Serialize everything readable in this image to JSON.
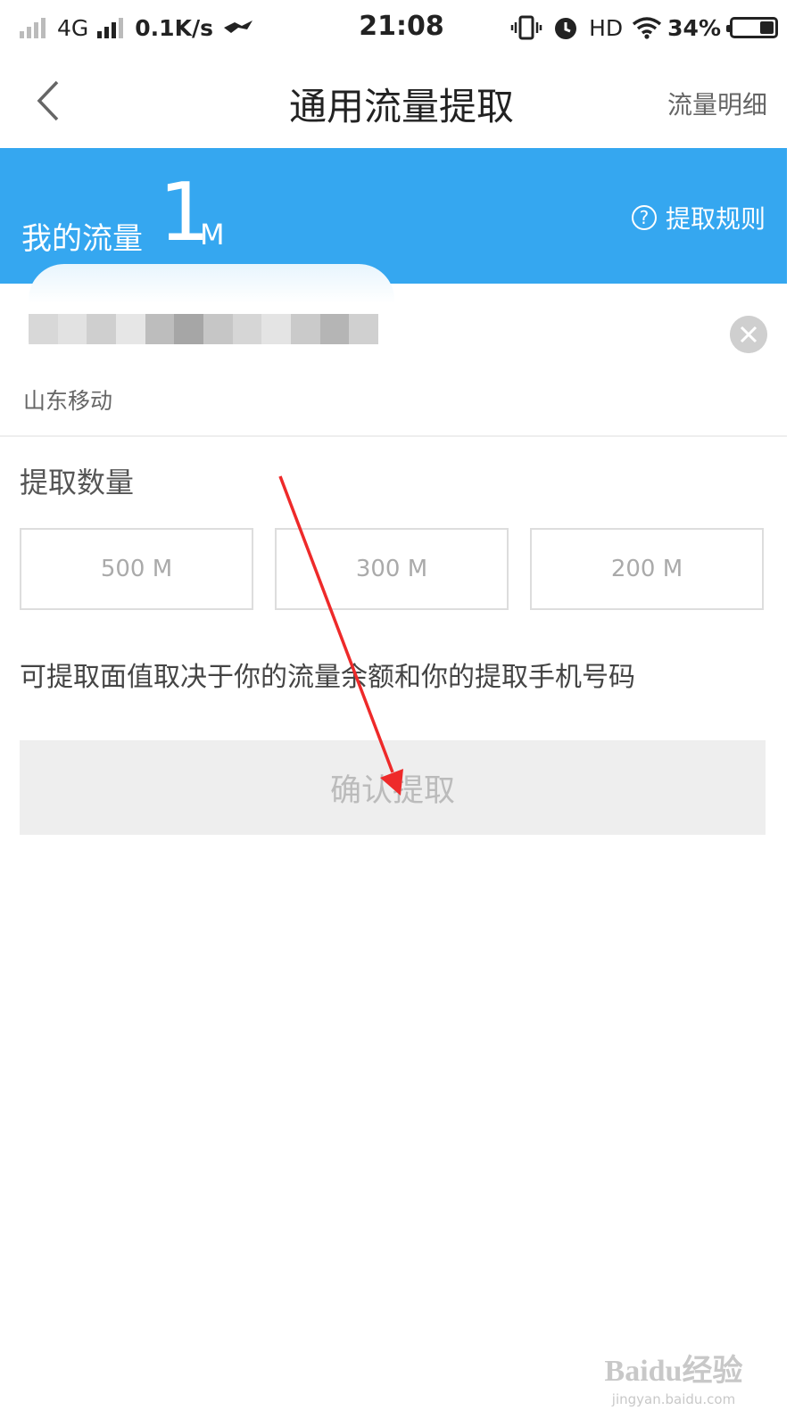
{
  "status_bar": {
    "network": "4G",
    "speed": "0.1K/s",
    "time": "21:08",
    "hd": "HD",
    "battery": "34%",
    "icons": [
      "signal-icon",
      "signal-icon",
      "hotspot-icon",
      "vibrate-icon",
      "alarm-icon",
      "wifi-icon",
      "battery-icon"
    ]
  },
  "nav": {
    "title": "通用流量提取",
    "right_link": "流量明细",
    "back_icon": "chevron-left-icon"
  },
  "banner": {
    "label": "我的流量",
    "amount": "1",
    "unit": "M",
    "rules_link": "提取规则",
    "rules_icon": "question-circle-icon",
    "color": "#35a7f0"
  },
  "phone": {
    "carrier": "山东移动",
    "clear_icon": "close-circle-icon"
  },
  "extract": {
    "section_title": "提取数量",
    "options": [
      "500 M",
      "300 M",
      "200 M"
    ],
    "hint": "可提取面值取决于你的流量余额和你的提取手机号码",
    "confirm_label": "确认提取"
  },
  "annotation": {
    "arrow_color": "#ee2a2a"
  },
  "watermark": {
    "logo": "Baidu经验",
    "url": "jingyan.baidu.com"
  }
}
